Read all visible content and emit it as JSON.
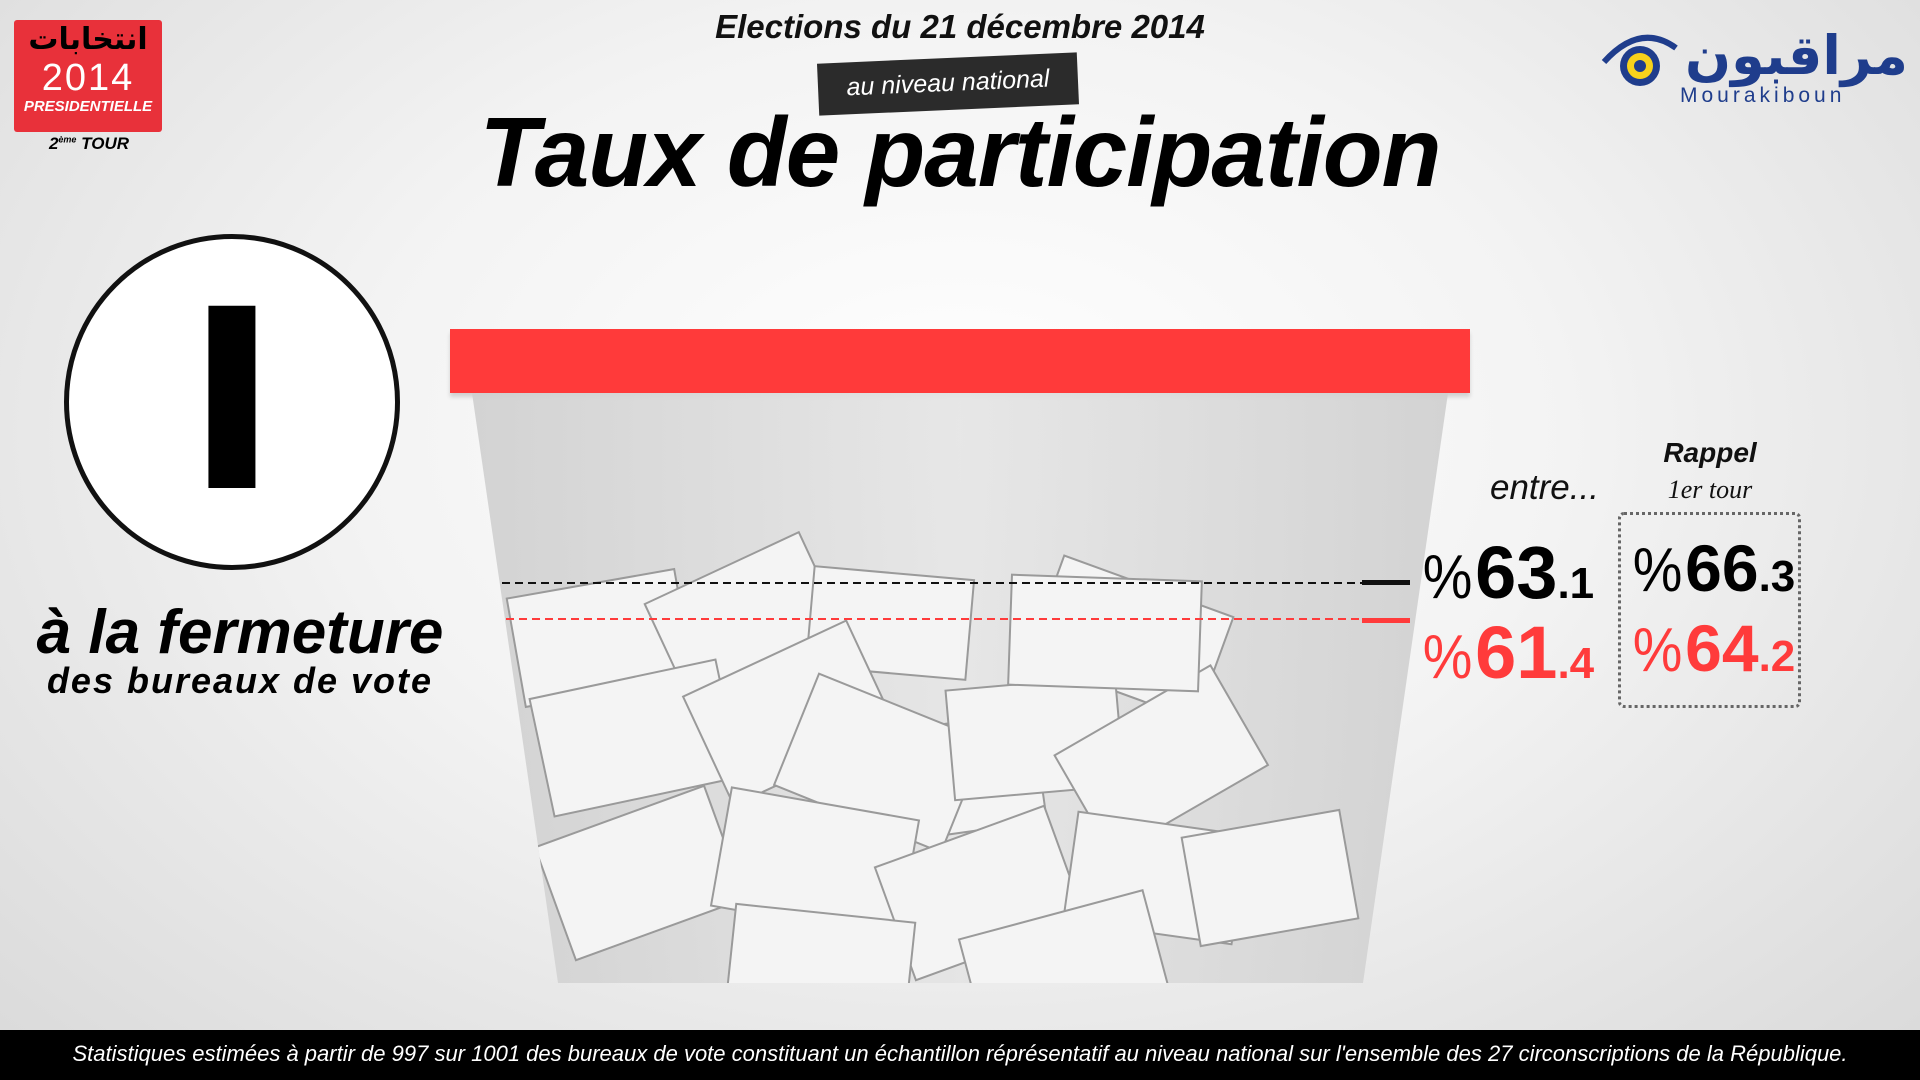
{
  "header": {
    "date_line": "Elections du 21 décembre 2014",
    "badge": "au niveau national",
    "title": "Taux de participation"
  },
  "election_logo": {
    "arabic": "انتخابات",
    "year": "2014",
    "type": "PRESIDENTIELLE",
    "tour_num": "2",
    "tour_sup": "ème",
    "tour_word": "TOUR"
  },
  "brand": {
    "arabic": "مراقبون",
    "latin": "Mourakiboun",
    "icon": "eye-icon",
    "color": "#1f3d8c"
  },
  "phase": {
    "number": "I",
    "label_line1": "à la fermeture",
    "label_line2": "des bureaux de vote"
  },
  "estimate": {
    "intro": "entre...",
    "upper": {
      "pct": "%",
      "int": "63",
      "dec": ".1"
    },
    "lower": {
      "pct": "%",
      "int": "61",
      "dec": ".4"
    }
  },
  "reminder": {
    "title": "Rappel",
    "subtitle": "1er tour",
    "upper": {
      "pct": "%",
      "int": "66",
      "dec": ".3"
    },
    "lower": {
      "pct": "%",
      "int": "64",
      "dec": ".2"
    }
  },
  "colors": {
    "accent_red": "#ff3b3b",
    "lid_red": "#ff3a3a",
    "badge_bg": "#2b2b2b"
  },
  "footer": "Statistiques estimées à partir de 997 sur 1001 des bureaux de vote constituant un échantillon réprésentatif au niveau national sur l'ensemble des 27 circonscriptions de la République."
}
